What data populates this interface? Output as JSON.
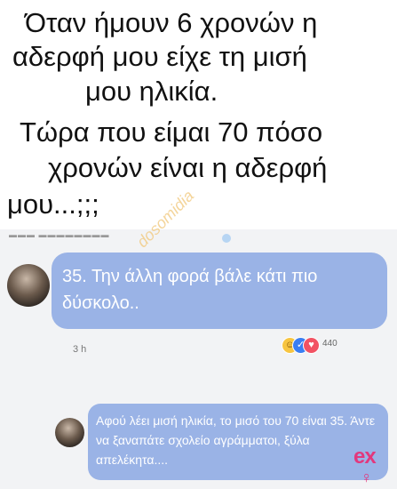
{
  "headline": {
    "lines": [
      "Όταν ήμουν 6 χρονών η",
      "αδερφή μου είχε τη μισή",
      "μου ηλικία.",
      "Τώρα που είμαι 70 πόσο",
      "χρονών είναι η αδερφή",
      "μου...;;;"
    ]
  },
  "watermark": "dosomidia",
  "top_comment": {
    "text": "35. Την άλλη φορά βάλε κάτι πιο δύσκολο..",
    "timestamp": "3 h",
    "reaction_count": "440",
    "reaction_icons": [
      "haha-icon",
      "like-icon",
      "love-icon"
    ]
  },
  "reply_comment": {
    "text": "Αφού λέει μισή ηλικία, το μισό του 70 είναι 35. Άντε να ξαναπάτε σχολείο αγράμματοι, ξύλα απελέκητα...."
  },
  "logo": {
    "text": "ex",
    "symbol": "♀"
  },
  "colors": {
    "bubble": "#9ab3e6",
    "logo": "#e2387d"
  }
}
